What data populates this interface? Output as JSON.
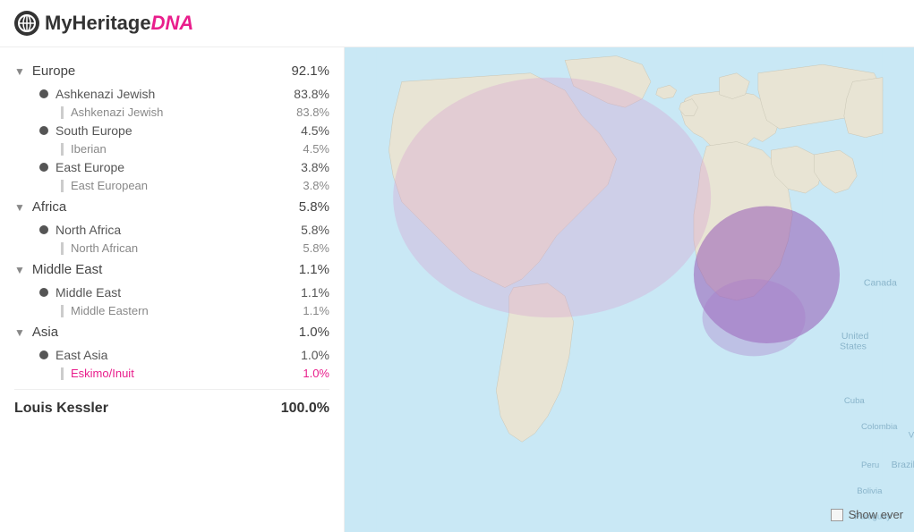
{
  "header": {
    "logo_text": "MyHeritage",
    "logo_dna": "DNA"
  },
  "sidebar": {
    "categories": [
      {
        "id": "europe",
        "label": "Europe",
        "pct": "92.1%",
        "expanded": true,
        "items": [
          {
            "label": "Ashkenazi Jewish",
            "pct": "83.8%",
            "sub_label": "Ashkenazi Jewish",
            "sub_pct": "83.8%",
            "sub_pink": false
          },
          {
            "label": "South Europe",
            "pct": "4.5%",
            "sub_label": "Iberian",
            "sub_pct": "4.5%",
            "sub_pink": false
          },
          {
            "label": "East Europe",
            "pct": "3.8%",
            "sub_label": "East European",
            "sub_pct": "3.8%",
            "sub_pink": false
          }
        ]
      },
      {
        "id": "africa",
        "label": "Africa",
        "pct": "5.8%",
        "expanded": true,
        "items": [
          {
            "label": "North Africa",
            "pct": "5.8%",
            "sub_label": "North African",
            "sub_pct": "5.8%",
            "sub_pink": false
          }
        ]
      },
      {
        "id": "middle_east",
        "label": "Middle East",
        "pct": "1.1%",
        "expanded": true,
        "items": [
          {
            "label": "Middle East",
            "pct": "1.1%",
            "sub_label": "Middle Eastern",
            "sub_pct": "1.1%",
            "sub_pink": false
          }
        ]
      },
      {
        "id": "asia",
        "label": "Asia",
        "pct": "1.0%",
        "expanded": true,
        "items": [
          {
            "label": "East Asia",
            "pct": "1.0%",
            "sub_label": "Eskimo/Inuit",
            "sub_pct": "1.0%",
            "sub_pink": true
          }
        ]
      }
    ],
    "footer": {
      "name": "Louis Kessler",
      "total_pct": "100.0%"
    }
  },
  "map": {
    "show_ever_label": "Show ever"
  }
}
